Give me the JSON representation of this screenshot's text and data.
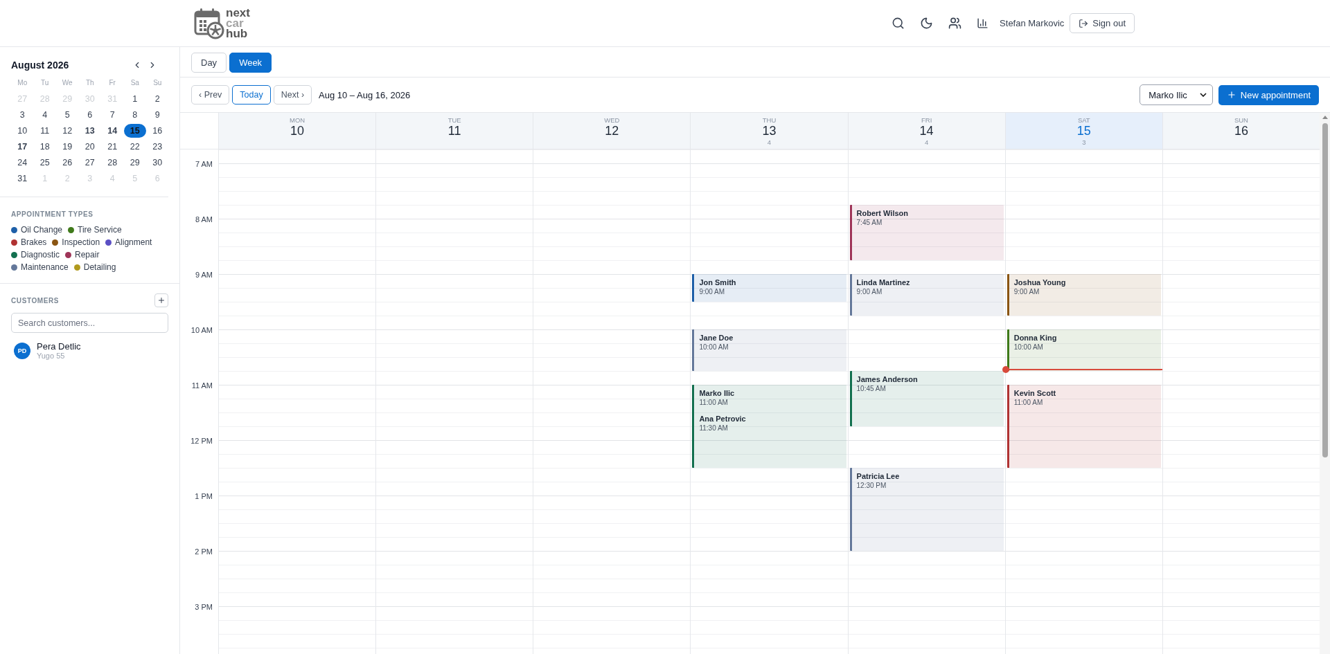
{
  "header": {
    "logo": [
      "next",
      "car",
      "hub"
    ],
    "user": "Stefan Markovic",
    "sign_out": "Sign out"
  },
  "mini_calendar": {
    "title": "August 2026",
    "weekdays": [
      "Mo",
      "Tu",
      "We",
      "Th",
      "Fr",
      "Sa",
      "Su"
    ],
    "weeks": [
      [
        {
          "label": "27",
          "muted": true,
          "bold": false,
          "selected": false
        },
        {
          "label": "28",
          "muted": true,
          "bold": false,
          "selected": false
        },
        {
          "label": "29",
          "muted": true,
          "bold": false,
          "selected": false
        },
        {
          "label": "30",
          "muted": true,
          "bold": false,
          "selected": false
        },
        {
          "label": "31",
          "muted": true,
          "bold": false,
          "selected": false
        },
        {
          "label": "1",
          "muted": false,
          "bold": false,
          "selected": false
        },
        {
          "label": "2",
          "muted": false,
          "bold": false,
          "selected": false
        }
      ],
      [
        {
          "label": "3",
          "muted": false,
          "bold": false,
          "selected": false
        },
        {
          "label": "4",
          "muted": false,
          "bold": false,
          "selected": false
        },
        {
          "label": "5",
          "muted": false,
          "bold": false,
          "selected": false
        },
        {
          "label": "6",
          "muted": false,
          "bold": false,
          "selected": false
        },
        {
          "label": "7",
          "muted": false,
          "bold": false,
          "selected": false
        },
        {
          "label": "8",
          "muted": false,
          "bold": false,
          "selected": false
        },
        {
          "label": "9",
          "muted": false,
          "bold": false,
          "selected": false
        }
      ],
      [
        {
          "label": "10",
          "muted": false,
          "bold": false,
          "selected": false
        },
        {
          "label": "11",
          "muted": false,
          "bold": false,
          "selected": false
        },
        {
          "label": "12",
          "muted": false,
          "bold": false,
          "selected": false
        },
        {
          "label": "13",
          "muted": false,
          "bold": true,
          "selected": false
        },
        {
          "label": "14",
          "muted": false,
          "bold": true,
          "selected": false
        },
        {
          "label": "15",
          "muted": false,
          "bold": true,
          "selected": true
        },
        {
          "label": "16",
          "muted": false,
          "bold": false,
          "selected": false
        }
      ],
      [
        {
          "label": "17",
          "muted": false,
          "bold": true,
          "selected": false
        },
        {
          "label": "18",
          "muted": false,
          "bold": false,
          "selected": false
        },
        {
          "label": "19",
          "muted": false,
          "bold": false,
          "selected": false
        },
        {
          "label": "20",
          "muted": false,
          "bold": false,
          "selected": false
        },
        {
          "label": "21",
          "muted": false,
          "bold": false,
          "selected": false
        },
        {
          "label": "22",
          "muted": false,
          "bold": false,
          "selected": false
        },
        {
          "label": "23",
          "muted": false,
          "bold": false,
          "selected": false
        }
      ],
      [
        {
          "label": "24",
          "muted": false,
          "bold": false,
          "selected": false
        },
        {
          "label": "25",
          "muted": false,
          "bold": false,
          "selected": false
        },
        {
          "label": "26",
          "muted": false,
          "bold": false,
          "selected": false
        },
        {
          "label": "27",
          "muted": false,
          "bold": false,
          "selected": false
        },
        {
          "label": "28",
          "muted": false,
          "bold": false,
          "selected": false
        },
        {
          "label": "29",
          "muted": false,
          "bold": false,
          "selected": false
        },
        {
          "label": "30",
          "muted": false,
          "bold": false,
          "selected": false
        }
      ],
      [
        {
          "label": "31",
          "muted": false,
          "bold": false,
          "selected": false
        },
        {
          "label": "1",
          "muted": true,
          "bold": false,
          "selected": false
        },
        {
          "label": "2",
          "muted": true,
          "bold": false,
          "selected": false
        },
        {
          "label": "3",
          "muted": true,
          "bold": false,
          "selected": false
        },
        {
          "label": "4",
          "muted": true,
          "bold": false,
          "selected": false
        },
        {
          "label": "5",
          "muted": true,
          "bold": false,
          "selected": false
        },
        {
          "label": "6",
          "muted": true,
          "bold": false,
          "selected": false
        }
      ]
    ]
  },
  "appointment_types": {
    "title": "APPOINTMENT TYPES",
    "items": [
      {
        "label": "Oil Change",
        "color": "#1e5fa8"
      },
      {
        "label": "Tire Service",
        "color": "#3f7a1a"
      },
      {
        "label": "Brakes",
        "color": "#b03232"
      },
      {
        "label": "Inspection",
        "color": "#8a5512"
      },
      {
        "label": "Alignment",
        "color": "#5b4fc4"
      },
      {
        "label": "Diagnostic",
        "color": "#13704f"
      },
      {
        "label": "Repair",
        "color": "#9e3458"
      },
      {
        "label": "Maintenance",
        "color": "#64789a"
      },
      {
        "label": "Detailing",
        "color": "#b09a1e"
      }
    ]
  },
  "customers": {
    "title": "CUSTOMERS",
    "search": {
      "placeholder": "Search customers..."
    },
    "items": [
      {
        "initials": "PD",
        "name": "Pera Detlic",
        "car": "Yugo 55"
      }
    ]
  },
  "view_tabs": [
    {
      "label": "Day",
      "selected": false
    },
    {
      "label": "Week",
      "selected": true
    }
  ],
  "toolbar": {
    "prev": "‹ Prev",
    "today": "Today",
    "next": "Next ›",
    "range": "Aug 10 – Aug 16, 2026",
    "mechanic": "Marko Ilic",
    "new_button": "New appointment"
  },
  "hours": [
    "7 AM",
    "8 AM",
    "9 AM",
    "10 AM",
    "11 AM",
    "12 PM",
    "1 PM",
    "2 PM",
    "3 PM"
  ],
  "days": [
    {
      "weekday": "MON",
      "date": "10",
      "selected": false
    },
    {
      "weekday": "TUE",
      "date": "11",
      "selected": false
    },
    {
      "weekday": "WED",
      "date": "12",
      "selected": false
    },
    {
      "weekday": "THU",
      "date": "13",
      "count": "4",
      "selected": false,
      "events": [
        {
          "color": "#1e5fa8",
          "entries": [
            {
              "name": "Jon Smith",
              "time": "9:00 AM"
            }
          ]
        },
        {
          "color": "#64789a",
          "entries": [
            {
              "name": "Jane Doe",
              "time": "10:00 AM"
            }
          ]
        },
        {
          "color": "#13704f",
          "entries": [
            {
              "name": "Marko Ilic",
              "time": "11:00 AM"
            },
            {
              "name": "Ana Petrovic",
              "time": "11:30 AM"
            }
          ]
        }
      ]
    },
    {
      "weekday": "FRI",
      "date": "14",
      "count": "4",
      "selected": false,
      "events": [
        {
          "color": "#9e3458",
          "entries": [
            {
              "name": "Robert Wilson",
              "time": "7:45 AM"
            }
          ]
        },
        {
          "color": "#64789a",
          "entries": [
            {
              "name": "Linda Martinez",
              "time": "9:00 AM"
            }
          ]
        },
        {
          "color": "#13704f",
          "entries": [
            {
              "name": "James Anderson",
              "time": "10:45 AM"
            }
          ]
        },
        {
          "color": "#64789a",
          "entries": [
            {
              "name": "Patricia Lee",
              "time": "12:30 PM"
            }
          ]
        }
      ]
    },
    {
      "weekday": "SAT",
      "date": "15",
      "count": "3",
      "selected": true,
      "events": [
        {
          "color": "#8a5512",
          "entries": [
            {
              "name": "Joshua Young",
              "time": "9:00 AM"
            }
          ]
        },
        {
          "color": "#3f7a1a",
          "entries": [
            {
              "name": "Donna King",
              "time": "10:00 AM"
            }
          ]
        },
        {
          "color": "#b03232",
          "entries": [
            {
              "name": "Kevin Scott",
              "time": "11:00 AM"
            }
          ]
        }
      ]
    },
    {
      "weekday": "SUN",
      "date": "16",
      "selected": false
    }
  ]
}
